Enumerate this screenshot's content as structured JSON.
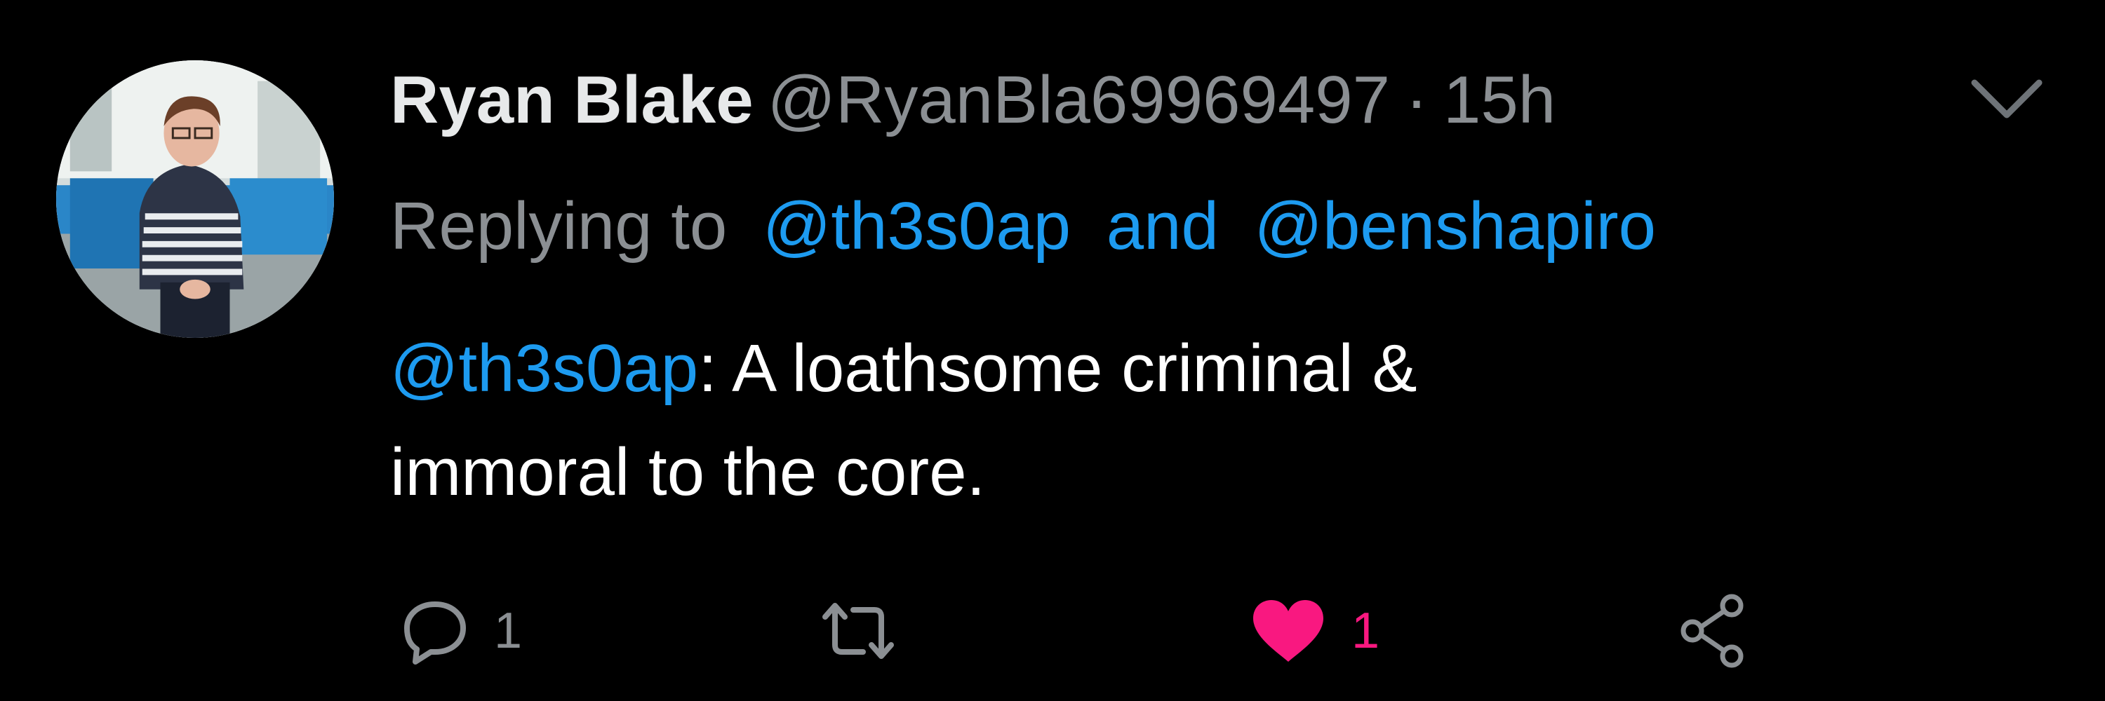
{
  "colors": {
    "background": "#000000",
    "name": "#e7e9ea",
    "muted": "#8b8f93",
    "link": "#1d9bf0",
    "like": "#f91880"
  },
  "tweet": {
    "author": {
      "display_name": "Ryan Blake",
      "handle": "@RyanBla69969497"
    },
    "separator": "·",
    "time": "15h",
    "replying": {
      "prefix": "Replying to",
      "mention_1": "@th3s0ap",
      "conjunction": "and",
      "mention_2": "@benshapiro"
    },
    "body": {
      "mention": "@th3s0ap",
      "line_1_rest": ": A loathsome criminal &",
      "line_2": "immoral to the core."
    },
    "actions": {
      "reply": {
        "icon": "comment-icon",
        "count": "1"
      },
      "retweet": {
        "icon": "retweet-icon"
      },
      "like": {
        "icon": "heart-icon",
        "count": "1",
        "liked": true
      },
      "share": {
        "icon": "share-icon"
      }
    },
    "menu_icon": "chevron-down-icon"
  }
}
